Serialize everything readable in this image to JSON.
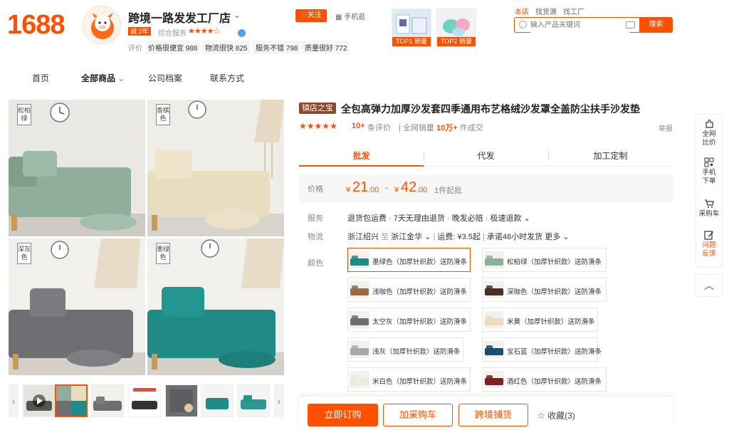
{
  "logo": "1688",
  "shop": {
    "name": "跨境一路发发工厂店",
    "years_badge": "诚 2年",
    "service_label": "综合服务",
    "stars": "★★★★☆",
    "eval_label": "评价",
    "eval_tags": [
      "价格很便宜 988",
      "物流很快 825",
      "服务不错 798",
      "质量很好 772"
    ],
    "follow": "♡关注",
    "phone_shop": "手机逛"
  },
  "top_products": [
    {
      "rank": "TOP1 销量"
    },
    {
      "rank": "TOP2 销量"
    }
  ],
  "search": {
    "scopes": [
      "本店",
      "找货源",
      "找工厂"
    ],
    "placeholder": "输入产品关键词",
    "button": "搜索"
  },
  "nav": [
    "首页",
    "全部商品",
    "公司档案",
    "联系方式"
  ],
  "gallery": {
    "labels": [
      "松柏绿",
      "香槟色",
      "深灰色",
      "墨绿色"
    ]
  },
  "product": {
    "badge": "镇店之宝",
    "title": "全包高弹力加厚沙发套四季通用布艺格绒沙发罩全盖防尘扶手沙发垫",
    "rating_stars": "★★★★★",
    "rating_count": "10+",
    "rating_suffix": "条评价",
    "sales_prefix": "| 全网销量 ",
    "sales_value": "10万+",
    "sales_suffix": " 件成交",
    "report": "举报"
  },
  "tabs": [
    "批发",
    "代发",
    "加工定制"
  ],
  "price": {
    "label": "价格",
    "low_int": "21",
    "low_dec": ".00",
    "high_int": "42",
    "high_dec": ".00",
    "yen": "¥",
    "dash": "~",
    "min_order": "1件起批"
  },
  "service": {
    "label": "服务",
    "text": "退货包运费 · 7天无理由退货 · 晚发必赔 · 极速退款 ⌄"
  },
  "logistics": {
    "label": "物流",
    "from": "浙江绍兴",
    "to_word": "至",
    "to": "浙江金华 ⌄",
    "fee": "运费: ¥3.5起",
    "promise": "承诺48小时发货",
    "more": "更多 ⌄"
  },
  "color": {
    "label": "颜色",
    "options": [
      {
        "name": "墨绿色（加厚针织款）送防滑条",
        "swatch": "#1f8a86"
      },
      {
        "name": "松柏绿（加厚针织款）送防滑条",
        "swatch": "#8fae9b"
      },
      {
        "name": "浅咖色（加厚针织款）送防滑条",
        "swatch": "#9a6b45"
      },
      {
        "name": "深咖色（加厚针织款）送防滑条",
        "swatch": "#4a3024"
      },
      {
        "name": "太空灰（加厚针织款）送防滑条",
        "swatch": "#6d6f72"
      },
      {
        "name": "米黄（加厚针织款）送防滑条",
        "swatch": "#e8dcc1"
      },
      {
        "name": "浅灰（加厚针织款）送防滑条",
        "swatch": "#a7a8a9"
      },
      {
        "name": "宝石蓝（加厚针织款）送防滑条",
        "swatch": "#1e4e6a"
      },
      {
        "name": "米白色（加厚针织款）送防滑条",
        "swatch": "#efeae0"
      },
      {
        "name": "酒红色（加厚针织款）送防滑条",
        "swatch": "#7e2024"
      }
    ]
  },
  "actions": {
    "buy": "立即订购",
    "cart": "加采购车",
    "cross": "跨境铺货",
    "fav": "☆ 收藏(3)"
  },
  "sidebar": {
    "compare": "全网比价",
    "mobile": "手机下单",
    "cart": "采购车",
    "feedback": "问题反馈",
    "top": "︿"
  },
  "colors": {
    "brand": "#ff5000"
  }
}
